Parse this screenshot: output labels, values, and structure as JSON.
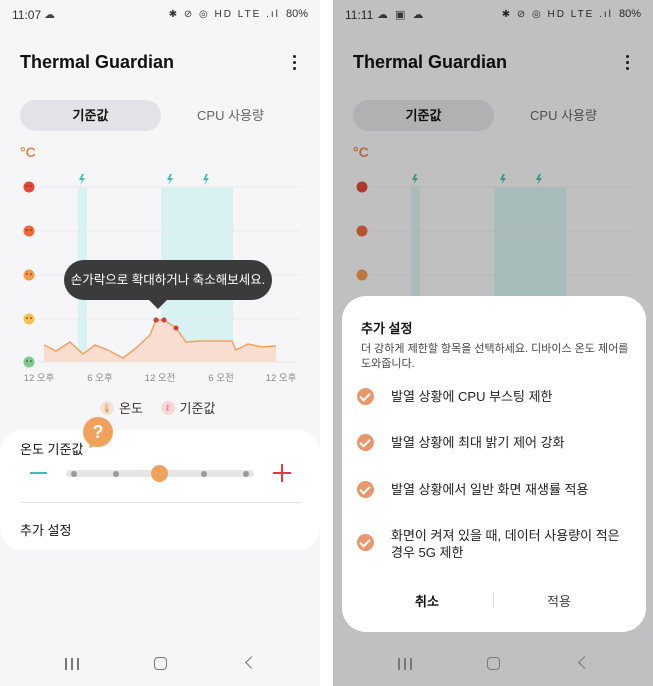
{
  "left": {
    "status": {
      "time": "11:07",
      "icons": "☁",
      "system": "✱ ⊘ ◎ HD LTE .ıl",
      "battery": "80%"
    },
    "app_title": "Thermal Guardian",
    "tabs": [
      "기준값",
      "CPU 사용량"
    ],
    "chart": {
      "unit": "°C",
      "x_labels": [
        "12 오후",
        "6 오후",
        "12 오전",
        "6 오전",
        "12 오후"
      ]
    },
    "tooltip": "손가락으로 확대하거나 축소해보세요.",
    "legend": {
      "temperature": "온도",
      "threshold": "기준값"
    },
    "threshold_card": {
      "label": "온도 기준값",
      "help": "?",
      "slider_value_fraction": 0.5
    },
    "extra_settings": "추가 설정"
  },
  "right": {
    "status": {
      "time": "11:11",
      "icons": "☁ ▣ ☁",
      "system": "✱ ⊘ ◎ HD LTE .ıl",
      "battery": "80%"
    },
    "app_title": "Thermal Guardian",
    "tabs": [
      "기준값",
      "CPU 사용량"
    ],
    "chart": {
      "unit": "°C"
    },
    "sheet": {
      "title": "추가 설정",
      "description": "더 강하게 제한할 항목을 선택하세요. 디바이스 온도 제어를 도와줍니다.",
      "options": [
        {
          "label": "발열 상황에 CPU 부스팅 제한",
          "checked": true
        },
        {
          "label": "발열 상황에 최대 밝기 제어 강화",
          "checked": true
        },
        {
          "label": "발열 상황에서 일반 화면 재생률 적용",
          "checked": true
        },
        {
          "label": "화면이 켜져 있을 때, 데이터 사용량이 적은 경우 5G 제한",
          "checked": true
        }
      ],
      "cancel": "취소",
      "apply": "적용"
    }
  },
  "colors": {
    "accent": "#f0a25c",
    "teal": "#3bbfb0",
    "red": "#e23b3b",
    "check": "#e8966b"
  }
}
